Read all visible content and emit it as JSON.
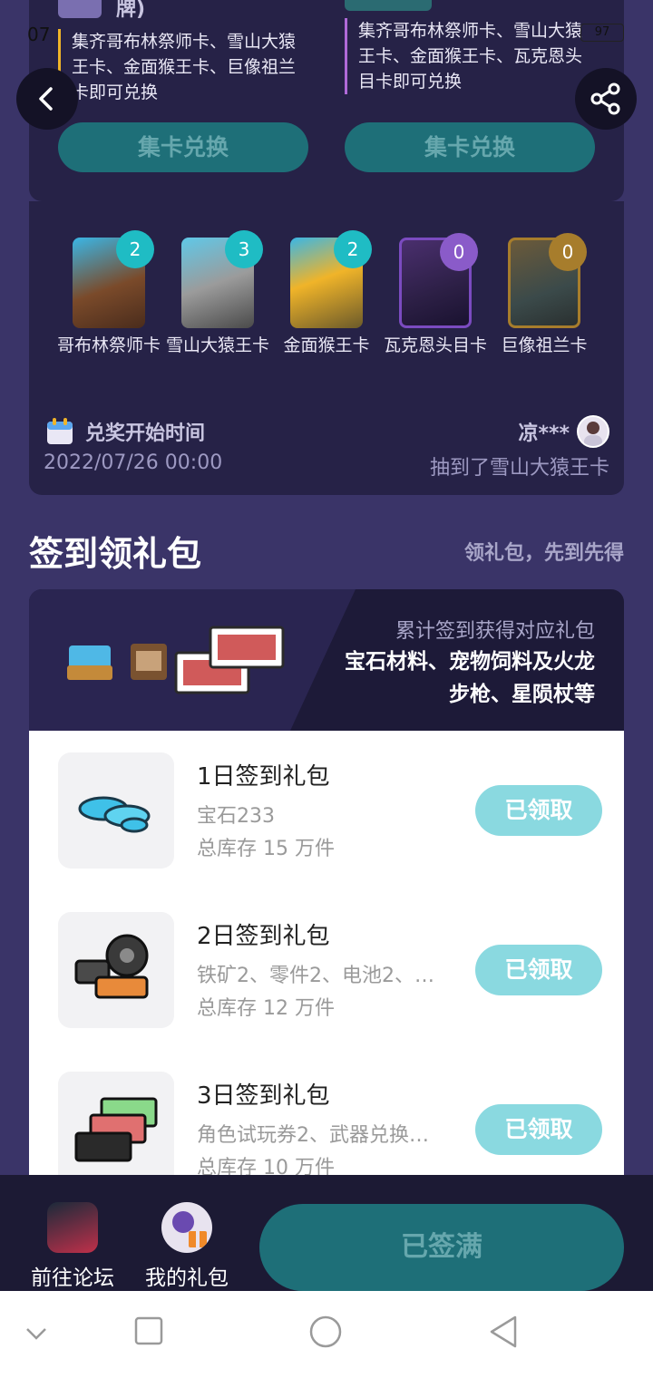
{
  "status": {
    "time": "07",
    "battery": "97"
  },
  "top_cards": [
    {
      "title": "牌)",
      "desc": "集齐哥布林祭师卡、雪山大猿王卡、金面猴王卡、巨像祖兰卡即可兑换",
      "button": "集卡兑换"
    },
    {
      "desc": "集齐哥布林祭师卡、雪山大猿王卡、金面猴王卡、瓦克恩头目卡即可兑换",
      "button": "集卡兑换"
    }
  ],
  "cards": [
    {
      "name": "哥布林祭师卡",
      "count": "2",
      "badge_color": "#1fbcc4"
    },
    {
      "name": "雪山大猿王卡",
      "count": "3",
      "badge_color": "#1fbcc4"
    },
    {
      "name": "金面猴王卡",
      "count": "2",
      "badge_color": "#1fbcc4"
    },
    {
      "name": "瓦克恩头目卡",
      "count": "0",
      "badge_color": "#8a5bc9"
    },
    {
      "name": "巨像祖兰卡",
      "count": "0",
      "badge_color": "#a77d2c"
    }
  ],
  "redeem": {
    "title": "兑奖开始时间",
    "date": "2022/07/26 00:00"
  },
  "winner": {
    "name": "凉***",
    "message": "抽到了雪山大猿王卡"
  },
  "signin": {
    "title": "签到领礼包",
    "subtitle": "领礼包，先到先得"
  },
  "gift_header": {
    "line1": "累计签到获得对应礼包",
    "line2": "宝石材料、宠物饲料及火龙步枪、星陨杖等"
  },
  "gifts": [
    {
      "name": "1日签到礼包",
      "content": "宝石233",
      "stock": "总库存 15 万件",
      "button": "已领取"
    },
    {
      "name": "2日签到礼包",
      "content": "铁矿2、零件2、电池2、…",
      "stock": "总库存 12 万件",
      "button": "已领取"
    },
    {
      "name": "3日签到礼包",
      "content": "角色试玩券2、武器兑换…",
      "stock": "总库存 10 万件",
      "button": "已领取"
    }
  ],
  "bottom": {
    "forum": "前往论坛",
    "my_gifts": "我的礼包",
    "signed": "已签满"
  },
  "colors": {
    "panel": "#262247",
    "teal_button": "#1e6f78",
    "claimed": "#8ad9e0",
    "background": "#3a3468"
  }
}
